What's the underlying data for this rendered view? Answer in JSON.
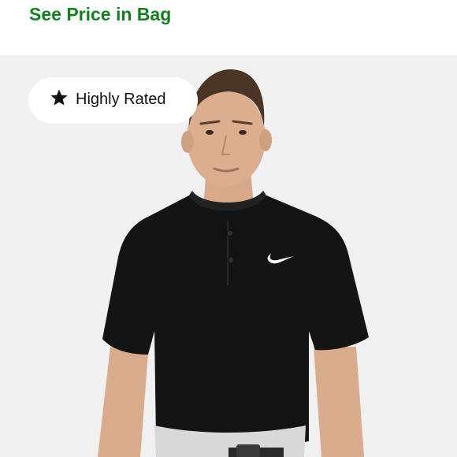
{
  "price": {
    "text": "See Price in Bag",
    "color": "#12801f"
  },
  "badge": {
    "icon": "star-icon",
    "label": "Highly Rated"
  },
  "product_image": {
    "description_icon": "product-photo",
    "background": "#f0f0f0",
    "shirt_color": "#141414"
  }
}
